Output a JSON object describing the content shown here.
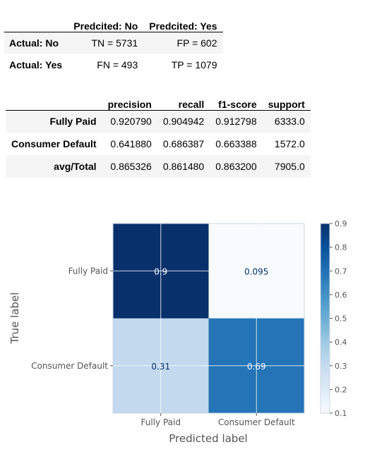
{
  "confusion_table": {
    "headers": [
      "",
      "Predcited: No",
      "Predcited: Yes"
    ],
    "rows": [
      {
        "label": "Actual: No",
        "cells": [
          "TN = 5731",
          "FP = 602"
        ]
      },
      {
        "label": "Actual: Yes",
        "cells": [
          "FN = 493",
          "TP = 1079"
        ]
      }
    ]
  },
  "report_table": {
    "headers": [
      "",
      "precision",
      "recall",
      "f1-score",
      "support"
    ],
    "rows": [
      {
        "label": "Fully Paid",
        "cells": [
          "0.920790",
          "0.904942",
          "0.912798",
          "6333.0"
        ]
      },
      {
        "label": "Consumer Default",
        "cells": [
          "0.641880",
          "0.686387",
          "0.663388",
          "1572.0"
        ]
      },
      {
        "label": "avg/Total",
        "cells": [
          "0.865326",
          "0.861480",
          "0.863200",
          "7905.0"
        ]
      }
    ]
  },
  "chart_data": {
    "type": "heatmap",
    "title": "",
    "xlabel": "Predicted label",
    "ylabel": "True label",
    "x_categories": [
      "Fully Paid",
      "Consumer Default"
    ],
    "y_categories": [
      "Fully Paid",
      "Consumer Default"
    ],
    "values": [
      [
        0.9,
        0.095
      ],
      [
        0.31,
        0.69
      ]
    ],
    "cell_labels": [
      [
        "0.9",
        "0.095"
      ],
      [
        "0.31",
        "0.69"
      ]
    ],
    "colormap": "Blues",
    "colorbar": {
      "range": [
        0.1,
        0.9
      ],
      "ticks": [
        "0.1",
        "0.2",
        "0.3",
        "0.4",
        "0.5",
        "0.6",
        "0.7",
        "0.8",
        "0.9"
      ]
    },
    "grid": true,
    "colors": {
      "low": "#f7fbff",
      "high": "#08306b",
      "cell_0_1": "#edf4fc",
      "cell_1_0": "#bad6eb",
      "cell_1_1": "#2b7bba"
    }
  }
}
